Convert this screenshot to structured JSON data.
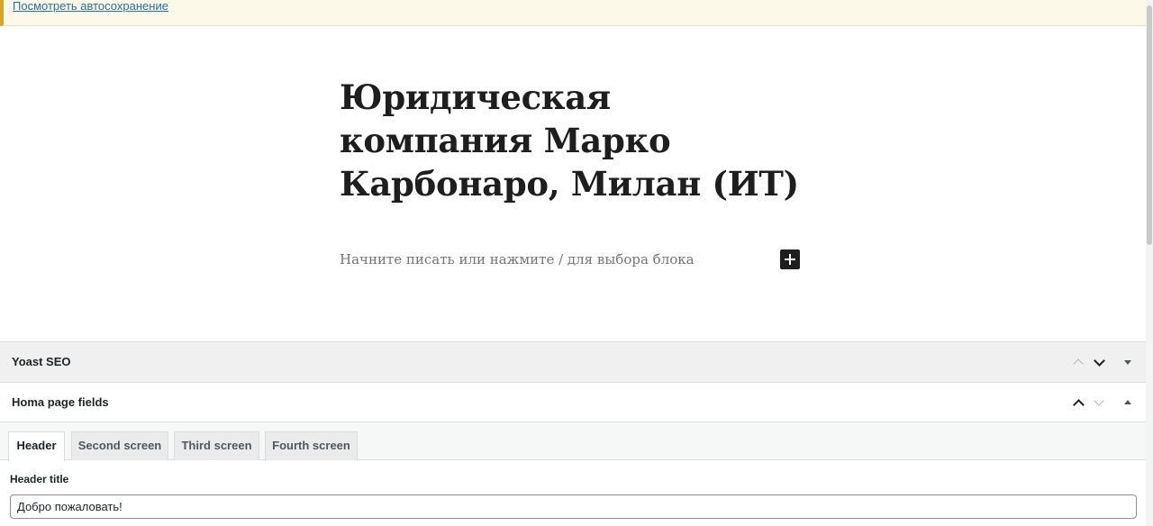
{
  "notice": {
    "link_text": "Посмотреть автосохранение"
  },
  "editor": {
    "post_title": "Юридическая компания Марко Карбонаро, Милан (ИТ)",
    "block_placeholder": "Начните писать или нажмите / для выбора блока",
    "add_block_icon": "plus-icon"
  },
  "metaboxes": {
    "yoast": {
      "title": "Yoast SEO"
    },
    "homa": {
      "title": "Homa page fields"
    }
  },
  "tabs": [
    {
      "label": "Header",
      "active": true
    },
    {
      "label": "Second screen",
      "active": false
    },
    {
      "label": "Third screen",
      "active": false
    },
    {
      "label": "Fourth screen",
      "active": false
    }
  ],
  "fields": {
    "header_title": {
      "label": "Header title",
      "value": "Добро пожаловать!"
    }
  },
  "colors": {
    "notice_background": "#fcf9e8",
    "notice_accent": "#dba617",
    "link": "#2271b1",
    "dark": "#1e1e1e"
  }
}
